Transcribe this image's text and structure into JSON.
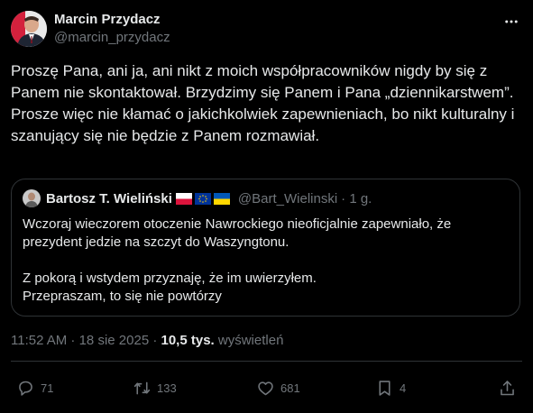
{
  "author": {
    "name": "Marcin Przydacz",
    "handle": "@marcin_przydacz"
  },
  "tweet_text": "Proszę Pana, ani ja, ani nikt z moich współpracowników nigdy by się z Panem nie skontaktował. Brzydzimy się Panem i Pana „dziennikarstwem”. Prosze więc nie kłamać o jakichkolwiek zapewnieniach, bo nikt kulturalny i szanujący się nie będzie z Panem rozmawiał.",
  "quoted": {
    "name": "Bartosz T. Wieliński",
    "handle": "@Bart_Wielinski",
    "time": "· 1 g.",
    "text": "Wczoraj wieczorem otoczenie Nawrockiego nieoficjalnie zapewniało, że prezydent jedzie na szczyt do Waszyngtonu.\n\nZ pokorą i wstydem przyznaję, że im uwierzyłem.\nPrzepraszam, to się nie powtórzy"
  },
  "meta": {
    "time": "11:52 AM · 18 sie 2025 · ",
    "views_count": "10,5 tys.",
    "views_label": " wyświetleń"
  },
  "actions": {
    "replies": "71",
    "reposts": "133",
    "likes": "681",
    "bookmarks": "4"
  },
  "icons": [
    "more-icon",
    "reply-icon",
    "repost-icon",
    "like-icon",
    "bookmark-icon",
    "share-icon"
  ],
  "colors": {
    "background": "#000000",
    "text": "#e7e9ea",
    "secondary": "#71767b",
    "border": "#2f3336"
  }
}
